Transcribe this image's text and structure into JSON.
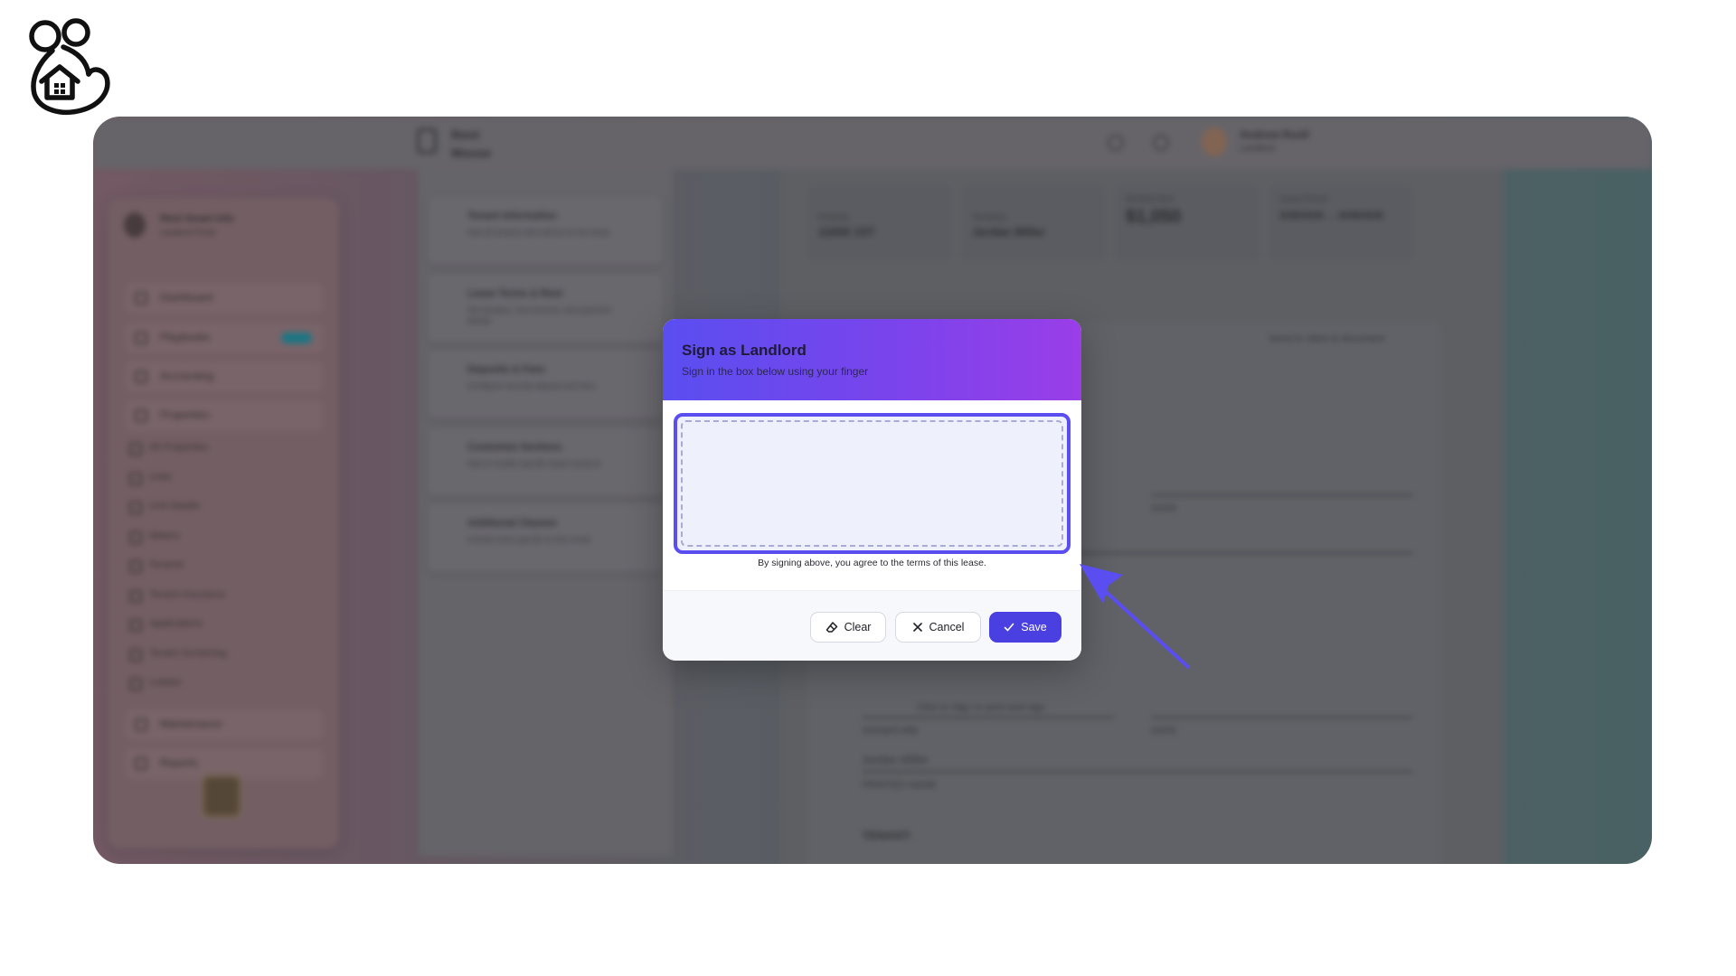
{
  "brand": {
    "logo_icon": "mouse-house-logo"
  },
  "background_app": {
    "brand_name": "Rent Mouse",
    "user_name": "Andrew Ruell",
    "user_role": "Landlord",
    "sidebar": {
      "profile_name": "Rent Smart Info",
      "profile_sub": "Landlord Portal",
      "nav": [
        {
          "label": "Dashboard",
          "icon": "grid-icon"
        },
        {
          "label": "Playbooks",
          "icon": "book-icon"
        },
        {
          "label": "Accounting",
          "icon": "dollar-icon"
        },
        {
          "label": "Properties",
          "icon": "building-icon"
        }
      ],
      "sub_items": [
        "All Properties",
        "Units",
        "Unit Details",
        "Meters",
        "Tenants",
        "Tenant Insurance",
        "Applications",
        "Tenant Screening",
        "Leases"
      ],
      "nav_bottom": [
        {
          "label": "Maintenance",
          "icon": "wrench-icon"
        },
        {
          "label": "Reports",
          "icon": "chart-icon"
        }
      ]
    },
    "lease_steps": [
      {
        "title": "Tenant Information",
        "sub": "Add all tenants who will be on the lease"
      },
      {
        "title": "Lease Terms & Rent",
        "sub": "Set duration, rent amount, and payment details"
      },
      {
        "title": "Deposits & Fees",
        "sub": "Configure security deposit and fees"
      },
      {
        "title": "Customize Sections",
        "sub": "Add or modify specific lease sections"
      },
      {
        "title": "Additional Clauses",
        "sub": "Include extra specific to this rental"
      }
    ],
    "summary": {
      "property_label": "Property",
      "property_value": "11650 1ST",
      "tenant_label": "Tenant(s)",
      "tenant_value": "Jordan Miller",
      "rent_label": "Monthly Rent",
      "rent_value": "$1,050",
      "period_label": "Lease Period",
      "period_value": "2/28/2026 → 8/28/2026"
    },
    "document": {
      "send_link": "Send to client & document",
      "date_label": "DATE",
      "click_to_sign": "Click to Sign or print and sign",
      "signature_label": "SIGNATURE",
      "tenant_printed": "Jordan Miller",
      "printed_name_label": "PRINTED NAME",
      "tenant_heading": "TENANT:"
    }
  },
  "modal": {
    "title": "Sign as Landlord",
    "subtitle": "Sign in the box below using your finger",
    "agreement_note": "By signing above, you agree to the terms of this lease.",
    "buttons": {
      "clear": "Clear",
      "cancel": "Cancel",
      "save": "Save"
    },
    "icons": {
      "clear": "eraser-icon",
      "cancel": "close-icon",
      "save": "check-icon"
    },
    "colors": {
      "header_start": "#5a4ef0",
      "header_end": "#9a3ee8",
      "accent": "#4a3fe0"
    }
  },
  "annotation": {
    "icon": "pointer-arrow-icon",
    "color": "#5a4ef0"
  }
}
